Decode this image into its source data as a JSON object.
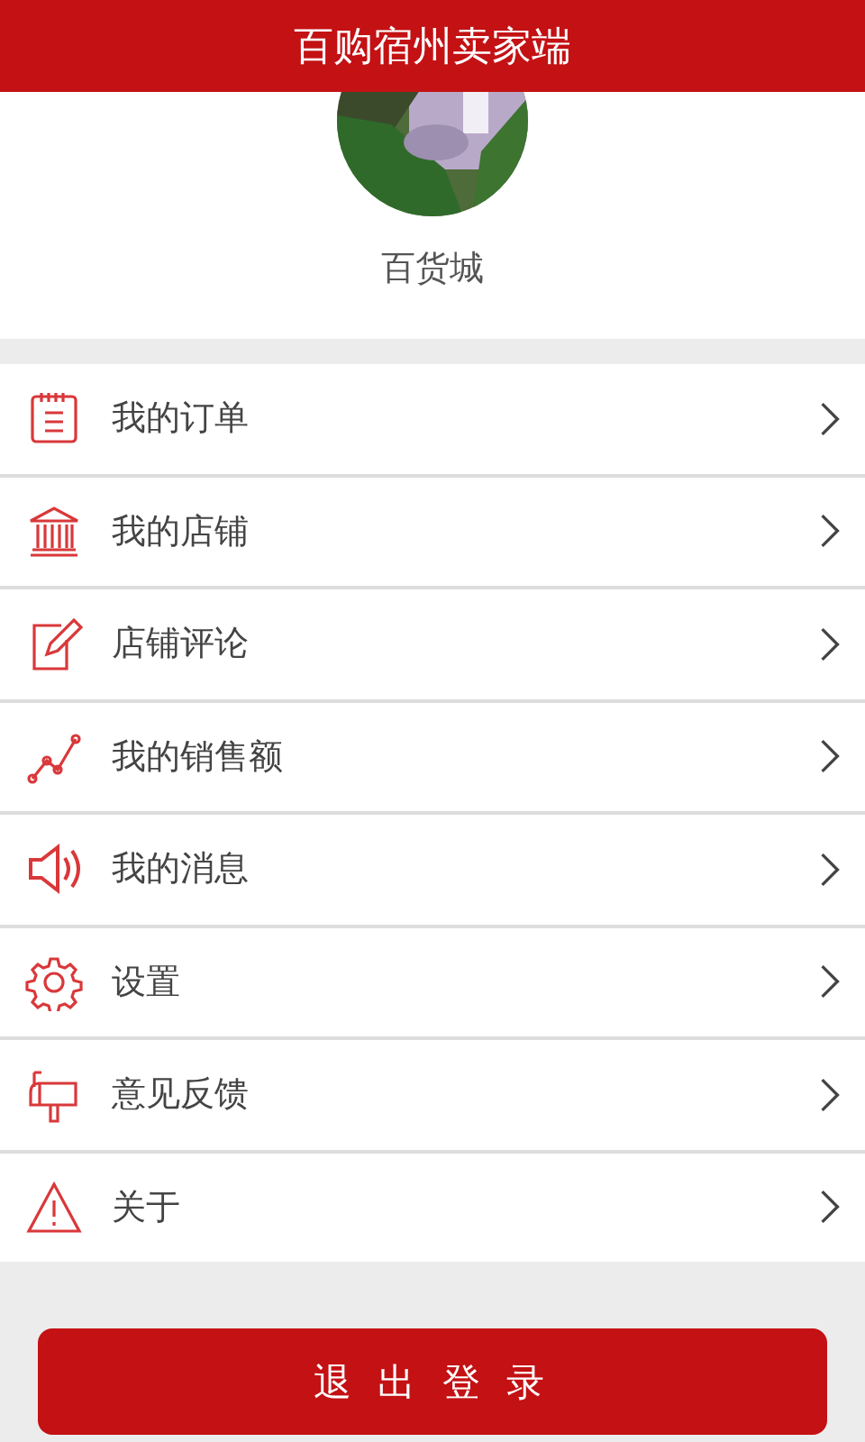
{
  "header": {
    "title": "百购宿州卖家端"
  },
  "profile": {
    "name": "百货城"
  },
  "menu": [
    {
      "kind": "order",
      "label": "我的订单"
    },
    {
      "kind": "shop",
      "label": "我的店铺"
    },
    {
      "kind": "review",
      "label": "店铺评论"
    },
    {
      "kind": "sales",
      "label": "我的销售额"
    },
    {
      "kind": "message",
      "label": "我的消息"
    },
    {
      "kind": "settings",
      "label": "设置"
    },
    {
      "kind": "feedback",
      "label": "意见反馈"
    },
    {
      "kind": "about",
      "label": "关于"
    }
  ],
  "logout_button": "退 出 登 录"
}
